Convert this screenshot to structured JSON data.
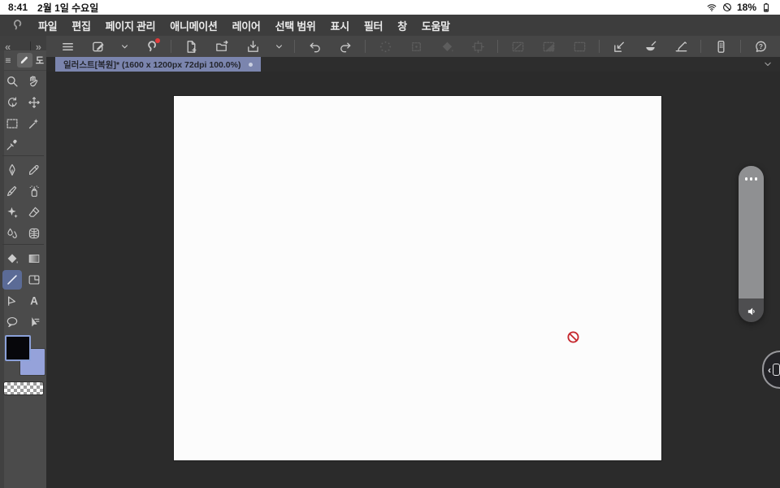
{
  "status_bar": {
    "time": "8:41",
    "date": "2월 1일 수요일",
    "battery": "18%",
    "icons": [
      "wifi",
      "do-not-disturb",
      "battery"
    ]
  },
  "menu_bar": {
    "logo": "clip-studio",
    "items": [
      {
        "key": "file",
        "label": "파일"
      },
      {
        "key": "edit",
        "label": "편집"
      },
      {
        "key": "page-management",
        "label": "페이지 관리"
      },
      {
        "key": "animation",
        "label": "애니메이션"
      },
      {
        "key": "layer",
        "label": "레이어"
      },
      {
        "key": "selection",
        "label": "선택 범위"
      },
      {
        "key": "view",
        "label": "표시"
      },
      {
        "key": "filter",
        "label": "필터"
      },
      {
        "key": "window",
        "label": "창"
      },
      {
        "key": "help",
        "label": "도움말"
      }
    ]
  },
  "toolbar": {
    "collapse_left": "«",
    "collapse_right": "»",
    "groups": [
      [
        {
          "key": "main-menu",
          "icon": "menu-lines"
        },
        {
          "key": "edit-shortcut",
          "icon": "pen-box"
        },
        {
          "key": "edit-shortcut-dropdown",
          "icon": "chevron-down",
          "narrow": true
        },
        {
          "key": "clip-studio-app",
          "icon": "cs-swirl",
          "badge": true
        }
      ],
      [
        {
          "key": "new-canvas",
          "icon": "file-plus"
        },
        {
          "key": "open-file",
          "icon": "folder-open"
        },
        {
          "key": "save",
          "icon": "save-tray"
        },
        {
          "key": "save-dropdown",
          "icon": "chevron-down",
          "narrow": true
        }
      ],
      [
        {
          "key": "undo",
          "icon": "undo"
        },
        {
          "key": "redo",
          "icon": "redo"
        }
      ],
      [
        {
          "key": "deselect",
          "icon": "spray-select",
          "disabled": true
        },
        {
          "key": "reselect",
          "icon": "blur-select",
          "disabled": true
        },
        {
          "key": "fill-selection",
          "icon": "fill-diamond",
          "disabled": true
        },
        {
          "key": "crop-selection",
          "icon": "crop-frame",
          "disabled": true
        }
      ],
      [
        {
          "key": "selection-line",
          "icon": "box-line",
          "disabled": true
        },
        {
          "key": "selection-tone",
          "icon": "box-gradient",
          "disabled": true
        },
        {
          "key": "selection-launcher",
          "icon": "box-marquee",
          "disabled": true
        }
      ],
      [
        {
          "key": "snap-to-ruler",
          "icon": "snap-ruler"
        },
        {
          "key": "snap-to-special-ruler",
          "icon": "snap-curve"
        },
        {
          "key": "snap-to-grid",
          "icon": "snap-grid"
        }
      ],
      [
        {
          "key": "companion-mode",
          "icon": "companion"
        }
      ],
      [
        {
          "key": "help",
          "icon": "help-bubble"
        }
      ]
    ]
  },
  "tab_bar": {
    "document_tab": {
      "title": "일러스트[복원]* (1600 x 1200px 72dpi 100.0%)",
      "modified_dot": true
    }
  },
  "sidebar": {
    "header": {
      "menu_icon": "panel-menu",
      "tool_icon": "pen-small",
      "label": "도"
    },
    "rows": [
      [
        {
          "key": "zoom",
          "icon": "magnifier"
        },
        {
          "key": "hand",
          "icon": "hand"
        }
      ],
      [
        {
          "key": "rotate-canvas",
          "icon": "rotate"
        },
        {
          "key": "move-layer",
          "icon": "move"
        }
      ],
      [
        {
          "key": "select-area",
          "icon": "marquee"
        },
        {
          "key": "auto-select",
          "icon": "wand"
        }
      ],
      [
        {
          "key": "eyedropper",
          "icon": "eyedropper"
        },
        null
      ],
      "divider",
      [
        {
          "key": "pen",
          "icon": "pen-nib"
        },
        {
          "key": "marker",
          "icon": "marker-pen"
        }
      ],
      [
        {
          "key": "brush",
          "icon": "brush"
        },
        {
          "key": "airbrush",
          "icon": "airbrush"
        }
      ],
      [
        {
          "key": "decoration",
          "icon": "sparkle"
        },
        {
          "key": "eraser",
          "icon": "eraser"
        }
      ],
      [
        {
          "key": "blend",
          "icon": "blend-drops"
        },
        {
          "key": "figure",
          "icon": "figure-grid"
        }
      ],
      "divider",
      [
        {
          "key": "fill",
          "icon": "fill-diamond"
        },
        {
          "key": "gradient",
          "icon": "gradient-square"
        }
      ],
      [
        {
          "key": "line",
          "icon": "line",
          "selected": true
        },
        {
          "key": "frame-border",
          "icon": "frame-border"
        }
      ],
      [
        {
          "key": "polyline",
          "icon": "polyline-flag"
        },
        {
          "key": "text",
          "icon": "text-a"
        }
      ],
      [
        {
          "key": "balloon",
          "icon": "balloon"
        },
        {
          "key": "object",
          "icon": "object-cursor"
        }
      ]
    ],
    "selected_tool": "line",
    "colors": {
      "foreground": "#07070b",
      "background": "#95a2da",
      "transparent_swatch": true
    }
  },
  "canvas": {
    "overlay_icon": "prohibited"
  },
  "volume_overlay": {
    "level_percent": 85,
    "more_icon": "more-dots",
    "bottom_icon": "speaker"
  },
  "edge_handle": {
    "chevron": "‹",
    "icon": "device-outline"
  },
  "colors": {
    "tab_active_bg": "#7b85ae",
    "tool_selected_bg": "#5b6b96",
    "swatch_selected_border": "#8ba0d8",
    "notification_badge": "#e23b3b",
    "prohibited_red": "#c5262c"
  }
}
